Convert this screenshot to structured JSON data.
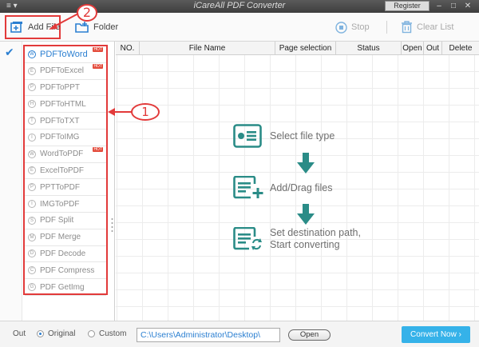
{
  "titlebar": {
    "menu_icon": "≡ ▾",
    "title": "iCareAll PDF Converter",
    "register_label": "Register"
  },
  "toolbar": {
    "add_file_label": "Add File",
    "folder_label": "Folder",
    "stop_label": "Stop",
    "clear_list_label": "Clear List"
  },
  "converters": [
    {
      "label": "PDFToWord",
      "hot": true,
      "active": true,
      "icon": "W"
    },
    {
      "label": "PDFToExcel",
      "hot": true,
      "active": false,
      "icon": "E"
    },
    {
      "label": "PDFToPPT",
      "hot": false,
      "active": false,
      "icon": "P"
    },
    {
      "label": "PDFToHTML",
      "hot": false,
      "active": false,
      "icon": "H"
    },
    {
      "label": "PDFToTXT",
      "hot": false,
      "active": false,
      "icon": "T"
    },
    {
      "label": "PDFToIMG",
      "hot": false,
      "active": false,
      "icon": "I"
    },
    {
      "label": "WordToPDF",
      "hot": true,
      "active": false,
      "icon": "W"
    },
    {
      "label": "ExcelToPDF",
      "hot": false,
      "active": false,
      "icon": "E"
    },
    {
      "label": "PPTToPDF",
      "hot": false,
      "active": false,
      "icon": "P"
    },
    {
      "label": "IMGToPDF",
      "hot": false,
      "active": false,
      "icon": "I"
    },
    {
      "label": "PDF Split",
      "hot": false,
      "active": false,
      "icon": "S"
    },
    {
      "label": "PDF Merge",
      "hot": false,
      "active": false,
      "icon": "M"
    },
    {
      "label": "PDF Decode",
      "hot": false,
      "active": false,
      "icon": "D"
    },
    {
      "label": "PDF Compress",
      "hot": false,
      "active": false,
      "icon": "C"
    },
    {
      "label": "PDF GetImg",
      "hot": false,
      "active": false,
      "icon": "G"
    }
  ],
  "hot_badge": "HOT",
  "table": {
    "headers": [
      "NO.",
      "File Name",
      "Page selection",
      "Status",
      "Open",
      "Out",
      "Delete"
    ]
  },
  "steps": {
    "step1": "Select file type",
    "step2": "Add/Drag files",
    "step3_line1": "Set destination path,",
    "step3_line2": "Start converting"
  },
  "bottom": {
    "out_label": "Out",
    "original_label": "Original",
    "custom_label": "Custom",
    "path_value": "C:\\Users\\Administrator\\Desktop\\",
    "open_label": "Open",
    "convert_label": "Convert Now",
    "output_mode": "Original"
  },
  "annotations": {
    "marker1": "1",
    "marker2": "2"
  },
  "colors": {
    "accent": "#2b7fd1",
    "teal": "#2a8c87",
    "convert_button": "#35b2e9",
    "annotation_red": "#e23a3a"
  }
}
